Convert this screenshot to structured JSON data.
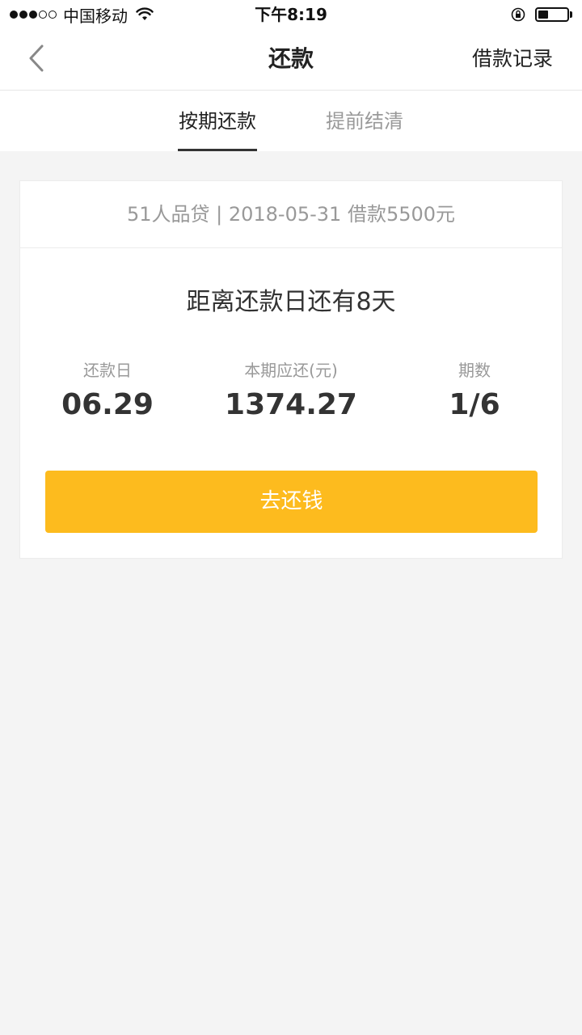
{
  "status_bar": {
    "carrier": "中国移动",
    "time": "下午8:19",
    "signal_filled": 3,
    "signal_total": 5,
    "battery_level": 0.35
  },
  "navbar": {
    "back_icon": "chevron-left-icon",
    "title": "还款",
    "action": "借款记录"
  },
  "tabs": [
    {
      "label": "按期还款",
      "active": true
    },
    {
      "label": "提前结清",
      "active": false
    }
  ],
  "loan": {
    "summary": "51人品贷 | 2018-05-31 借款5500元",
    "countdown": "距离还款日还有8天",
    "stats": [
      {
        "label": "还款日",
        "value": "06.29"
      },
      {
        "label": "本期应还(元)",
        "value": "1374.27"
      },
      {
        "label": "期数",
        "value": "1/6"
      }
    ],
    "pay_button": "去还钱"
  },
  "colors": {
    "accent": "#fdbb1e",
    "background": "#f4f4f4",
    "text_primary": "#333333",
    "text_secondary": "#999999"
  }
}
